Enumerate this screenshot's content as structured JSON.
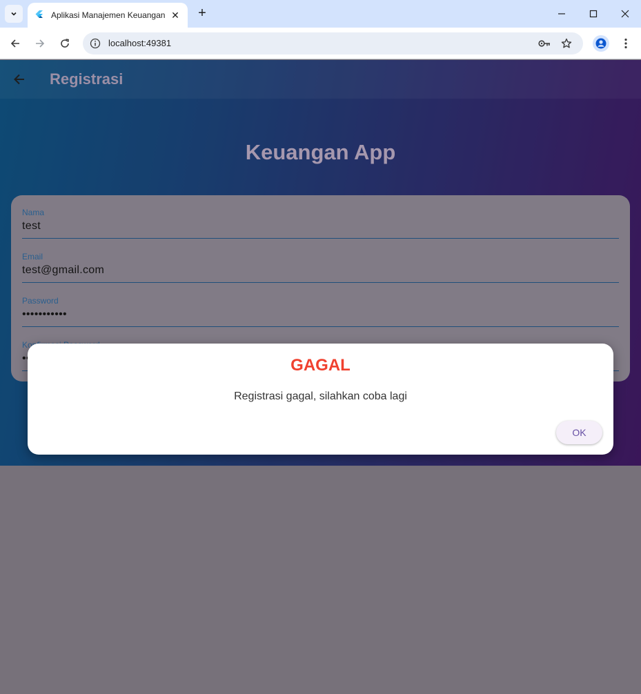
{
  "browser": {
    "tab_title": "Aplikasi Manajemen Keuangan",
    "url": "localhost:49381"
  },
  "appbar": {
    "title": "Registrasi"
  },
  "brand": {
    "title": "Keuangan App"
  },
  "form": {
    "fields": [
      {
        "label": "Nama",
        "value": "test"
      },
      {
        "label": "Email",
        "value": "test@gmail.com"
      },
      {
        "label": "Password",
        "value": "•••••••••••"
      },
      {
        "label": "Konfirmasi Password",
        "value": "•••••••••••"
      }
    ]
  },
  "dialog": {
    "title": "GAGAL",
    "message": "Registrasi gagal, silahkan coba lagi",
    "ok_label": "OK"
  },
  "colors": {
    "error": "#f0412f",
    "button_text": "#6750a4",
    "gradient_start": "#125f95",
    "gradient_end": "#4b1d72"
  }
}
